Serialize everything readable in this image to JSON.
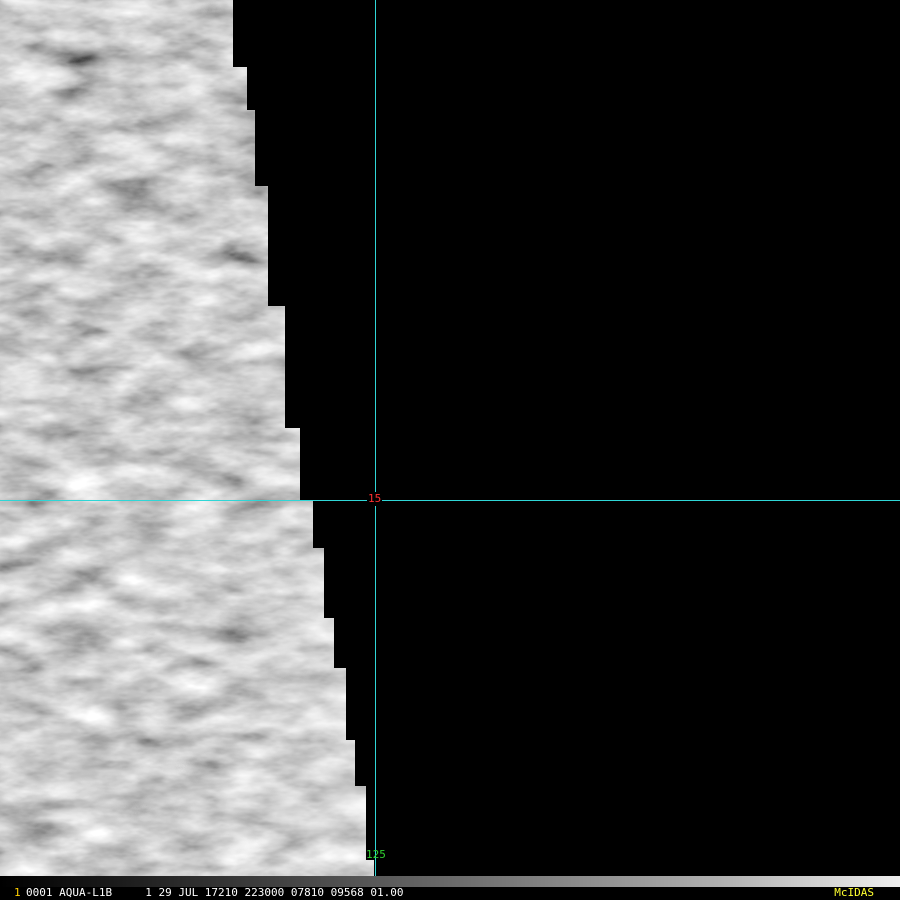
{
  "image": {
    "description_colors": {
      "crosshair": "#2fd6d6",
      "lat_label": "#ff3030",
      "lon_label": "#30d030"
    }
  },
  "overlay": {
    "lat_label": "15",
    "lon_label": "125"
  },
  "status": {
    "frame_number": "1",
    "line": "0001 AQUA-L1B     1 29 JUL 17210 223000 07810 09568 01.00",
    "brand": "McIDAS"
  }
}
